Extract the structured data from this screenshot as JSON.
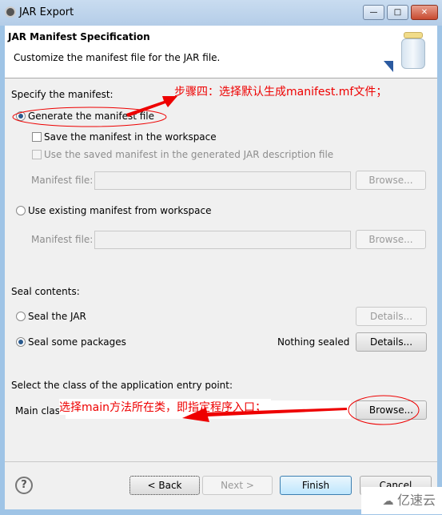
{
  "window": {
    "title": "JAR Export",
    "minimize": "—",
    "maximize": "□",
    "close": "✕"
  },
  "header": {
    "title": "JAR Manifest Specification",
    "description": "Customize the manifest file for the JAR file."
  },
  "manifest": {
    "section_label": "Specify the manifest:",
    "generate_label": "Generate the manifest file",
    "save_label": "Save the manifest in the workspace",
    "use_saved_label": "Use the saved manifest in the generated JAR description file",
    "manifest_file_label": "Manifest file:",
    "browse_label": "Browse...",
    "use_existing_label": "Use existing manifest from workspace",
    "manifest_file_label2": "Manifest file:",
    "browse_label2": "Browse..."
  },
  "seal": {
    "section_label": "Seal contents:",
    "seal_jar_label": "Seal the JAR",
    "details_label": "Details...",
    "seal_some_label": "Seal some packages",
    "status": "Nothing sealed",
    "details_label2": "Details..."
  },
  "entry": {
    "section_label": "Select the class of the application entry point:",
    "main_class_label": "Main class:",
    "main_class_value": "",
    "browse_label": "Browse..."
  },
  "footer": {
    "help": "?",
    "back": "< Back",
    "next": "Next >",
    "finish": "Finish",
    "cancel": "Cancel"
  },
  "annotations": {
    "step4": "步骤四：选择默认生成manifest.mf文件；",
    "main_note": "选择main方法所在类，即指定程序入口；",
    "color": "#e00000"
  },
  "watermark": "亿速云"
}
